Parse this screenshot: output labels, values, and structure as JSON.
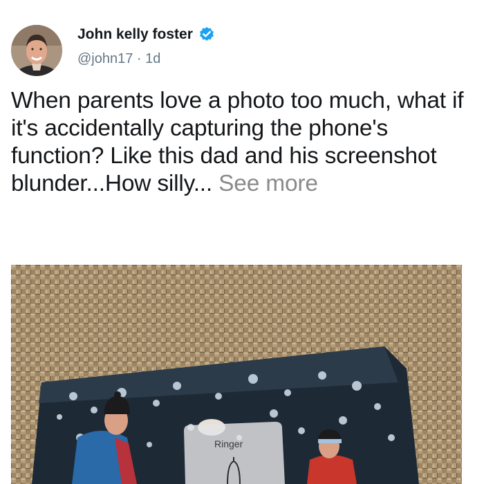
{
  "post": {
    "author_name": "John kelly foster",
    "handle": "@john17",
    "separator": " · ",
    "time": "1d",
    "text": "When parents love a photo too much, what if it's accidentally capturing the phone's function? Like this dad and his screenshot blunder...How silly...",
    "see_more": "See more"
  },
  "media": {
    "ringer_label": "Ringer"
  },
  "colors": {
    "verified": "#1da1f2",
    "muted_text": "#657786",
    "see_more": "#8a8a8a"
  },
  "icons": {
    "verified": "verified-badge-icon"
  }
}
